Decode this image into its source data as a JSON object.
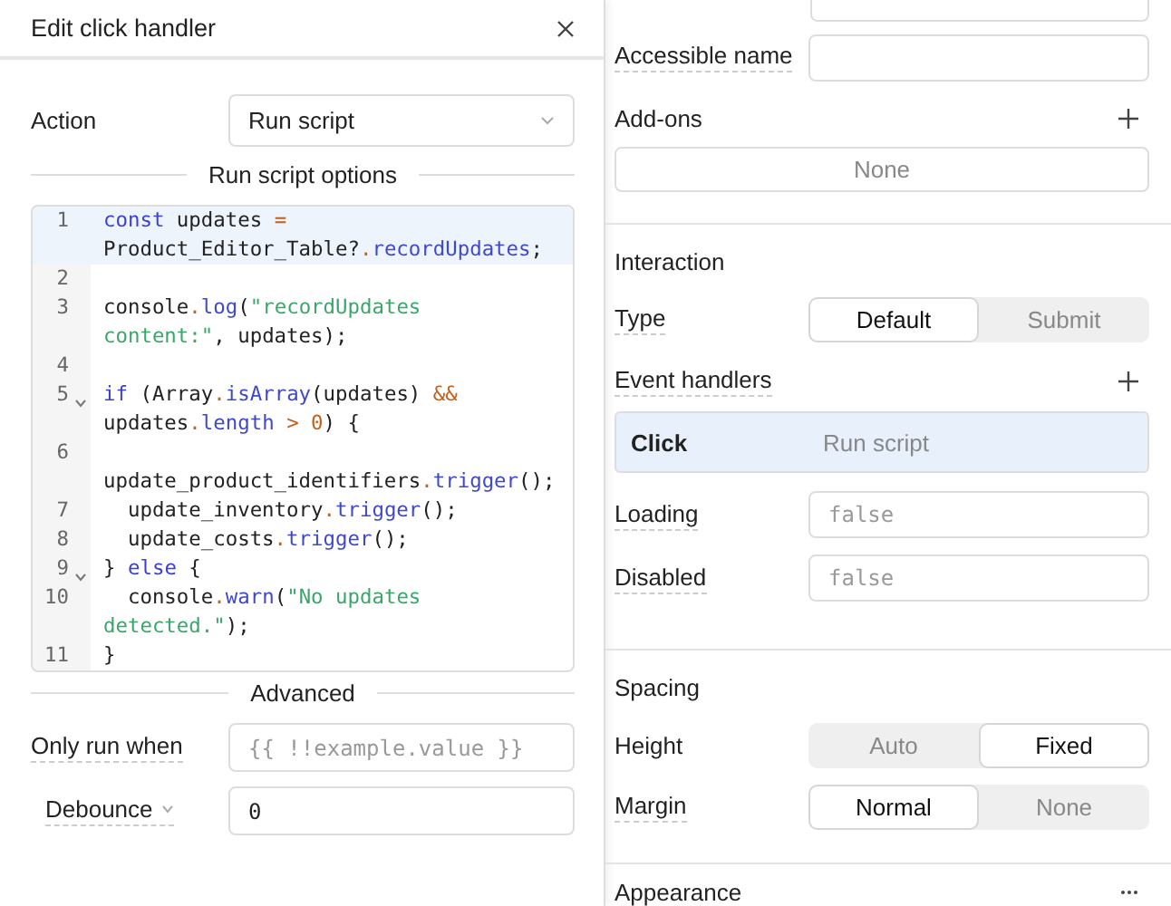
{
  "dialog": {
    "title": "Edit click handler",
    "action": {
      "label": "Action",
      "value": "Run script"
    },
    "options_title": "Run script options",
    "code": [
      {
        "number": "1",
        "fold": false,
        "active": true,
        "tokens": [
          {
            "kind": "kw",
            "text": "const"
          },
          {
            "kind": "plain",
            "text": " updates "
          },
          {
            "kind": "op",
            "text": "="
          }
        ]
      },
      {
        "fold": false,
        "active": true,
        "tokens": [
          {
            "kind": "plain",
            "text": "Product_Editor_Table?"
          },
          {
            "kind": "op",
            "text": "."
          },
          {
            "kind": "fn",
            "text": "recordUpdates"
          },
          {
            "kind": "plain",
            "text": ";"
          }
        ]
      },
      {
        "number": "2",
        "fold": false,
        "active": false
      },
      {
        "number": "3",
        "fold": false,
        "active": false,
        "tokens": [
          {
            "kind": "plain",
            "text": "console"
          },
          {
            "kind": "op",
            "text": "."
          },
          {
            "kind": "fn",
            "text": "log"
          },
          {
            "kind": "plain",
            "text": "("
          },
          {
            "kind": "str",
            "text": "\"recordUpdates"
          }
        ]
      },
      {
        "fold": false,
        "active": false,
        "tokens": [
          {
            "kind": "str",
            "text": "content:\""
          },
          {
            "kind": "plain",
            "text": ", updates);"
          }
        ]
      },
      {
        "number": "4",
        "fold": false,
        "active": false
      },
      {
        "number": "5",
        "fold": true,
        "active": false,
        "tokens": [
          {
            "kind": "kw",
            "text": "if"
          },
          {
            "kind": "plain",
            "text": " (Array"
          },
          {
            "kind": "op",
            "text": "."
          },
          {
            "kind": "fn",
            "text": "isArray"
          },
          {
            "kind": "plain",
            "text": "(updates) "
          },
          {
            "kind": "op",
            "text": "&&"
          }
        ]
      },
      {
        "fold": false,
        "active": false,
        "tokens": [
          {
            "kind": "plain",
            "text": "updates"
          },
          {
            "kind": "op",
            "text": "."
          },
          {
            "kind": "fn",
            "text": "length"
          },
          {
            "kind": "op",
            "text": " > 0"
          },
          {
            "kind": "plain",
            "text": ") {"
          }
        ]
      },
      {
        "number": "6",
        "fold": false,
        "active": false
      },
      {
        "fold": false,
        "active": false,
        "tokens": [
          {
            "kind": "plain",
            "text": "update_product_identifiers"
          },
          {
            "kind": "op",
            "text": "."
          },
          {
            "kind": "fn",
            "text": "trigger"
          },
          {
            "kind": "plain",
            "text": "();"
          }
        ]
      },
      {
        "number": "7",
        "fold": false,
        "active": false,
        "tokens": [
          {
            "kind": "plain",
            "text": "  update_inventory"
          },
          {
            "kind": "op",
            "text": "."
          },
          {
            "kind": "fn",
            "text": "trigger"
          },
          {
            "kind": "plain",
            "text": "();"
          }
        ]
      },
      {
        "number": "8",
        "fold": false,
        "active": false,
        "tokens": [
          {
            "kind": "plain",
            "text": "  update_costs"
          },
          {
            "kind": "op",
            "text": "."
          },
          {
            "kind": "fn",
            "text": "trigger"
          },
          {
            "kind": "plain",
            "text": "();"
          }
        ]
      },
      {
        "number": "9",
        "fold": true,
        "active": false,
        "tokens": [
          {
            "kind": "plain",
            "text": "} "
          },
          {
            "kind": "kw",
            "text": "else"
          },
          {
            "kind": "plain",
            "text": " {"
          }
        ]
      },
      {
        "number": "10",
        "fold": false,
        "active": false,
        "tokens": [
          {
            "kind": "plain",
            "text": "  console"
          },
          {
            "kind": "op",
            "text": "."
          },
          {
            "kind": "fn",
            "text": "warn"
          },
          {
            "kind": "plain",
            "text": "("
          },
          {
            "kind": "str",
            "text": "\"No updates"
          }
        ]
      },
      {
        "fold": false,
        "active": false,
        "tokens": [
          {
            "kind": "str",
            "text": "detected.\""
          },
          {
            "kind": "plain",
            "text": ");"
          }
        ]
      },
      {
        "number": "11",
        "fold": false,
        "active": false,
        "tokens": [
          {
            "kind": "plain",
            "text": "}"
          }
        ]
      }
    ],
    "advanced_title": "Advanced",
    "only_run_when": {
      "label": "Only run when",
      "placeholder": "{{ !!example.value }}"
    },
    "debounce": {
      "label": "Debounce",
      "value": "0"
    }
  },
  "inspector": {
    "accessible_name": {
      "label": "Accessible name"
    },
    "addons": {
      "label": "Add-ons",
      "value": "None"
    },
    "interaction": {
      "title": "Interaction",
      "type": {
        "label": "Type",
        "options": [
          {
            "label": "Default",
            "selected": true
          },
          {
            "label": "Submit",
            "selected": false
          }
        ]
      },
      "event_handlers": {
        "label": "Event handlers",
        "items": [
          {
            "event": "Click",
            "action": "Run script",
            "selected": true
          }
        ]
      },
      "loading": {
        "label": "Loading",
        "placeholder": "false"
      },
      "disabled": {
        "label": "Disabled",
        "placeholder": "false"
      }
    },
    "spacing": {
      "title": "Spacing",
      "height": {
        "label": "Height",
        "options": [
          {
            "label": "Auto",
            "selected": false
          },
          {
            "label": "Fixed",
            "selected": true
          }
        ]
      },
      "margin": {
        "label": "Margin",
        "options": [
          {
            "label": "Normal",
            "selected": true
          },
          {
            "label": "None",
            "selected": false
          }
        ]
      }
    },
    "appearance": {
      "title": "Appearance"
    }
  }
}
